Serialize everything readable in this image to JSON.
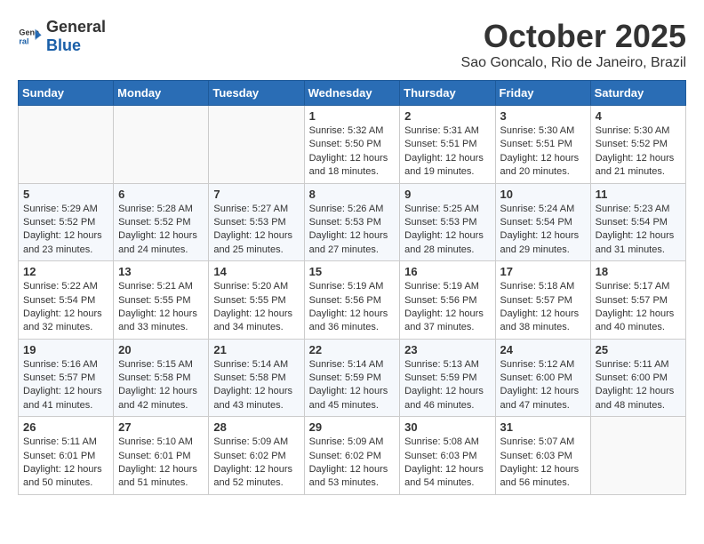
{
  "header": {
    "logo": {
      "text_general": "General",
      "text_blue": "Blue"
    },
    "title": "October 2025",
    "subtitle": "Sao Goncalo, Rio de Janeiro, Brazil"
  },
  "weekdays": [
    "Sunday",
    "Monday",
    "Tuesday",
    "Wednesday",
    "Thursday",
    "Friday",
    "Saturday"
  ],
  "weeks": [
    [
      {
        "day": "",
        "info": ""
      },
      {
        "day": "",
        "info": ""
      },
      {
        "day": "",
        "info": ""
      },
      {
        "day": "1",
        "info": "Sunrise: 5:32 AM\nSunset: 5:50 PM\nDaylight: 12 hours and 18 minutes."
      },
      {
        "day": "2",
        "info": "Sunrise: 5:31 AM\nSunset: 5:51 PM\nDaylight: 12 hours and 19 minutes."
      },
      {
        "day": "3",
        "info": "Sunrise: 5:30 AM\nSunset: 5:51 PM\nDaylight: 12 hours and 20 minutes."
      },
      {
        "day": "4",
        "info": "Sunrise: 5:30 AM\nSunset: 5:52 PM\nDaylight: 12 hours and 21 minutes."
      }
    ],
    [
      {
        "day": "5",
        "info": "Sunrise: 5:29 AM\nSunset: 5:52 PM\nDaylight: 12 hours and 23 minutes."
      },
      {
        "day": "6",
        "info": "Sunrise: 5:28 AM\nSunset: 5:52 PM\nDaylight: 12 hours and 24 minutes."
      },
      {
        "day": "7",
        "info": "Sunrise: 5:27 AM\nSunset: 5:53 PM\nDaylight: 12 hours and 25 minutes."
      },
      {
        "day": "8",
        "info": "Sunrise: 5:26 AM\nSunset: 5:53 PM\nDaylight: 12 hours and 27 minutes."
      },
      {
        "day": "9",
        "info": "Sunrise: 5:25 AM\nSunset: 5:53 PM\nDaylight: 12 hours and 28 minutes."
      },
      {
        "day": "10",
        "info": "Sunrise: 5:24 AM\nSunset: 5:54 PM\nDaylight: 12 hours and 29 minutes."
      },
      {
        "day": "11",
        "info": "Sunrise: 5:23 AM\nSunset: 5:54 PM\nDaylight: 12 hours and 31 minutes."
      }
    ],
    [
      {
        "day": "12",
        "info": "Sunrise: 5:22 AM\nSunset: 5:54 PM\nDaylight: 12 hours and 32 minutes."
      },
      {
        "day": "13",
        "info": "Sunrise: 5:21 AM\nSunset: 5:55 PM\nDaylight: 12 hours and 33 minutes."
      },
      {
        "day": "14",
        "info": "Sunrise: 5:20 AM\nSunset: 5:55 PM\nDaylight: 12 hours and 34 minutes."
      },
      {
        "day": "15",
        "info": "Sunrise: 5:19 AM\nSunset: 5:56 PM\nDaylight: 12 hours and 36 minutes."
      },
      {
        "day": "16",
        "info": "Sunrise: 5:19 AM\nSunset: 5:56 PM\nDaylight: 12 hours and 37 minutes."
      },
      {
        "day": "17",
        "info": "Sunrise: 5:18 AM\nSunset: 5:57 PM\nDaylight: 12 hours and 38 minutes."
      },
      {
        "day": "18",
        "info": "Sunrise: 5:17 AM\nSunset: 5:57 PM\nDaylight: 12 hours and 40 minutes."
      }
    ],
    [
      {
        "day": "19",
        "info": "Sunrise: 5:16 AM\nSunset: 5:57 PM\nDaylight: 12 hours and 41 minutes."
      },
      {
        "day": "20",
        "info": "Sunrise: 5:15 AM\nSunset: 5:58 PM\nDaylight: 12 hours and 42 minutes."
      },
      {
        "day": "21",
        "info": "Sunrise: 5:14 AM\nSunset: 5:58 PM\nDaylight: 12 hours and 43 minutes."
      },
      {
        "day": "22",
        "info": "Sunrise: 5:14 AM\nSunset: 5:59 PM\nDaylight: 12 hours and 45 minutes."
      },
      {
        "day": "23",
        "info": "Sunrise: 5:13 AM\nSunset: 5:59 PM\nDaylight: 12 hours and 46 minutes."
      },
      {
        "day": "24",
        "info": "Sunrise: 5:12 AM\nSunset: 6:00 PM\nDaylight: 12 hours and 47 minutes."
      },
      {
        "day": "25",
        "info": "Sunrise: 5:11 AM\nSunset: 6:00 PM\nDaylight: 12 hours and 48 minutes."
      }
    ],
    [
      {
        "day": "26",
        "info": "Sunrise: 5:11 AM\nSunset: 6:01 PM\nDaylight: 12 hours and 50 minutes."
      },
      {
        "day": "27",
        "info": "Sunrise: 5:10 AM\nSunset: 6:01 PM\nDaylight: 12 hours and 51 minutes."
      },
      {
        "day": "28",
        "info": "Sunrise: 5:09 AM\nSunset: 6:02 PM\nDaylight: 12 hours and 52 minutes."
      },
      {
        "day": "29",
        "info": "Sunrise: 5:09 AM\nSunset: 6:02 PM\nDaylight: 12 hours and 53 minutes."
      },
      {
        "day": "30",
        "info": "Sunrise: 5:08 AM\nSunset: 6:03 PM\nDaylight: 12 hours and 54 minutes."
      },
      {
        "day": "31",
        "info": "Sunrise: 5:07 AM\nSunset: 6:03 PM\nDaylight: 12 hours and 56 minutes."
      },
      {
        "day": "",
        "info": ""
      }
    ]
  ]
}
